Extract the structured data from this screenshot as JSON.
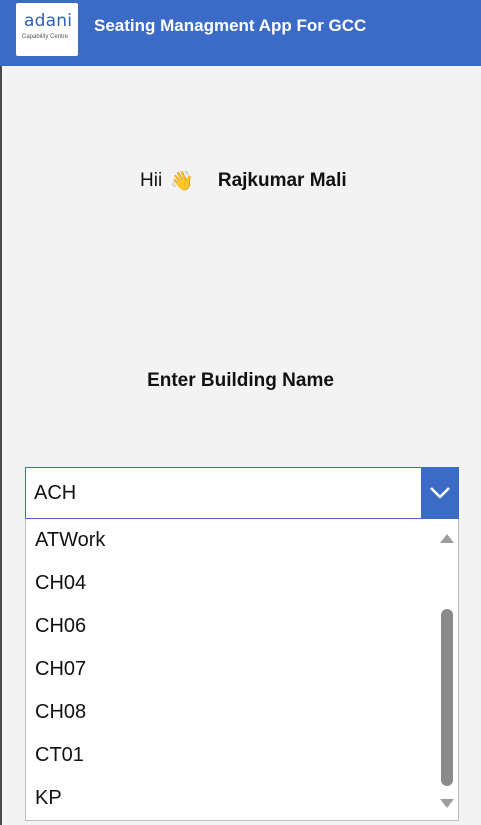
{
  "header": {
    "title": "Seating Managment App For GCC",
    "logo_text": "adani",
    "logo_subtext": "Capability Centre"
  },
  "greeting": {
    "prefix": "Hii",
    "emoji": "👋",
    "user_name": "Rajkumar Mali"
  },
  "building": {
    "prompt": "Enter Building Name",
    "selected": "ACH",
    "options": [
      "ATWork",
      "CH04",
      "CH06",
      "CH07",
      "CH08",
      "CT01",
      "KP"
    ]
  },
  "colors": {
    "header_bg": "#3c6bc7",
    "accent": "#3c6bc7"
  }
}
